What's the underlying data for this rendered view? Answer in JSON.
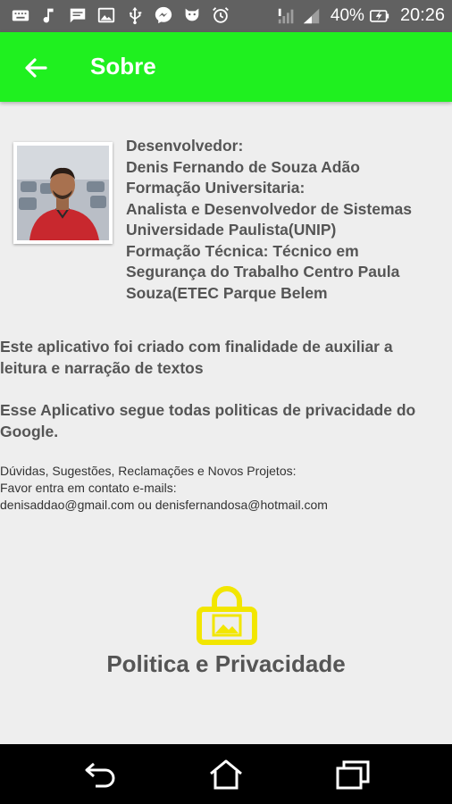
{
  "status_bar": {
    "battery": "40%",
    "time": "20:26"
  },
  "app_bar": {
    "title": "Sobre",
    "color": "#1ff01f"
  },
  "developer": {
    "lines": [
      "Desenvolvedor:",
      "Denis Fernando de Souza Adão",
      "Formação Universitaria:",
      "Analista e Desenvolvedor de Sistemas",
      "Universidade Paulista(UNIP)",
      "Formação Técnica: Técnico em",
      "Segurança do Trabalho Centro Paula",
      "Souza(ETEC Parque Belem"
    ]
  },
  "paragraphs": {
    "purpose_1": "Este aplicativo foi criado com finalidade de auxiliar a",
    "purpose_2": "leitura e narração de textos",
    "privacy_1": "Esse Aplicativo segue todas politicas de privacidade do",
    "privacy_2": "Google."
  },
  "contact": {
    "line1": "Dúvidas, Sugestões, Reclamações e Novos Projetos:",
    "line2": "Favor entra em contato e-mails:",
    "line3": "denisaddao@gmail.com ou denisfernandosa@hotmail.com"
  },
  "privacy_link": {
    "label": "Politica e Privacidade",
    "icon": "lock-icon",
    "icon_color": "#f2e600"
  }
}
